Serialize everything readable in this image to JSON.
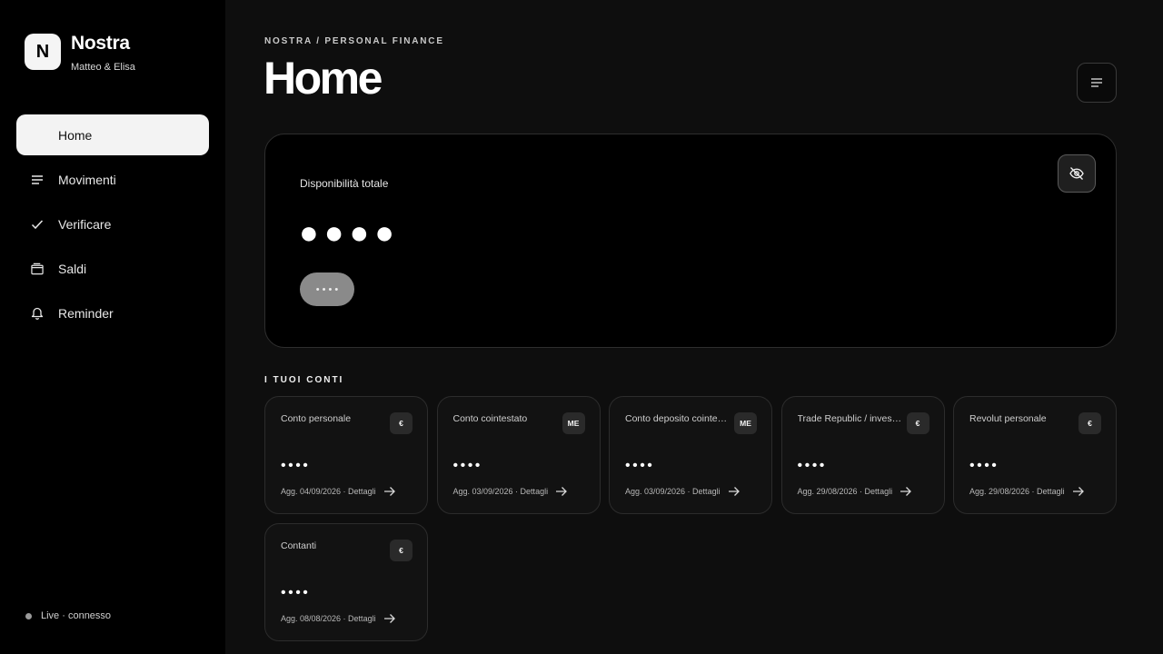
{
  "brand": {
    "logo_letter": "N",
    "name": "Nostra",
    "subtitle": "Matteo & Elisa"
  },
  "sidebar": {
    "items": [
      {
        "label": "Home",
        "icon": "none",
        "active": true
      },
      {
        "label": "Movimenti",
        "icon": "list-icon",
        "active": false
      },
      {
        "label": "Verificare",
        "icon": "check-icon",
        "active": false
      },
      {
        "label": "Saldi",
        "icon": "wallet-icon",
        "active": false
      },
      {
        "label": "Reminder",
        "icon": "bell-icon",
        "active": false
      }
    ],
    "status": "Live · connesso"
  },
  "header": {
    "breadcrumb": "NOSTRA / PERSONAL FINANCE",
    "title": "Home"
  },
  "balance": {
    "label": "Disponibilità totale",
    "value": "●●●●",
    "pill": "••••"
  },
  "accounts": {
    "section_title": "I TUOI CONTI",
    "items": [
      {
        "name": "Conto personale",
        "badge": "€",
        "value": "••••",
        "updated": "Agg. 04/09/2026 · Dettagli"
      },
      {
        "name": "Conto cointestato",
        "badge": "ME",
        "value": "••••",
        "updated": "Agg. 03/09/2026 · Dettagli"
      },
      {
        "name": "Conto deposito cointestato",
        "badge": "ME",
        "value": "••••",
        "updated": "Agg. 03/09/2026 · Dettagli"
      },
      {
        "name": "Trade Republic / investimenti",
        "badge": "€",
        "value": "••••",
        "updated": "Agg. 29/08/2026 · Dettagli"
      },
      {
        "name": "Revolut personale",
        "badge": "€",
        "value": "••••",
        "updated": "Agg. 29/08/2026 · Dettagli"
      },
      {
        "name": "Contanti",
        "badge": "€",
        "value": "••••",
        "updated": "Agg. 08/08/2026 · Dettagli"
      }
    ]
  },
  "colors": {
    "background": "#0e0e0e",
    "sidebar": "#000000",
    "active_nav": "#f3f3f3",
    "card_border": "#2c2c2c"
  }
}
